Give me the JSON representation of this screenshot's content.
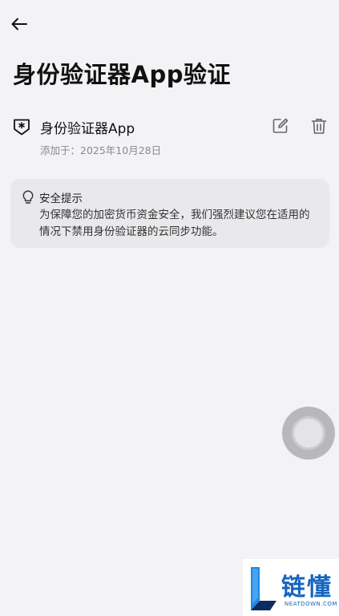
{
  "header": {
    "back_icon": "arrow-left-icon",
    "title": "身份验证器App验证"
  },
  "authenticator": {
    "icon": "shield-star-icon",
    "name": "身份验证器App",
    "added_label": "添加于：2025年10月28日",
    "edit_icon": "edit-icon",
    "delete_icon": "trash-icon"
  },
  "tip": {
    "icon": "lightbulb-icon",
    "title": "安全提示",
    "body": "为保障您的加密货币资金安全，我们强烈建议您在适用的情况下禁用身份验证器的云同步功能。"
  },
  "floating_ball": {
    "icon": "assistive-touch-icon"
  },
  "watermark": {
    "brand_cn": "链懂",
    "brand_en": "NEATDOWN.COM"
  },
  "colors": {
    "background": "#f3f2f5",
    "card": "#e9e8eb",
    "text_primary": "#111111",
    "text_secondary": "#8a8a8e",
    "watermark_blue": "#1565c0"
  }
}
